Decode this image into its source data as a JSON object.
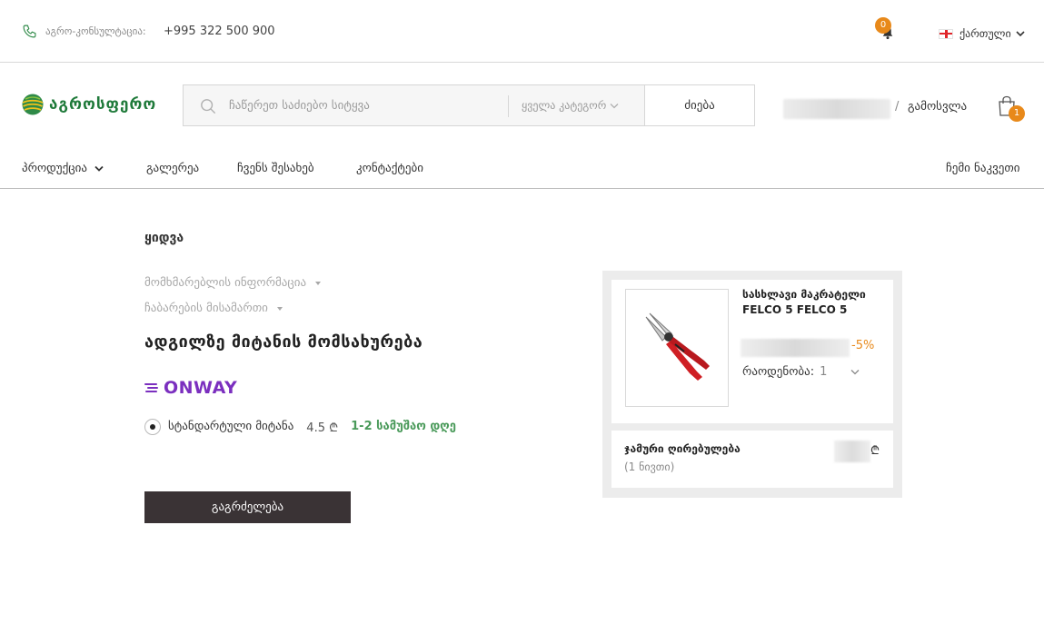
{
  "topbar": {
    "consult_label": "აგრო-კონსულტაცია:",
    "phone": "+995 322 500 900",
    "notifications_count": "0",
    "language": "ქართული"
  },
  "header": {
    "logo_text": "აგროსფერო",
    "search_placeholder": "ჩაწერეთ საძიებო სიტყვა",
    "category_select": "ყველა კატეგორ",
    "search_button": "ძიება",
    "slash": "/",
    "logout": "გამოსვლა",
    "cart_count": "1"
  },
  "nav": {
    "products": "პროდუქცია",
    "gallery": "გალერეა",
    "about": "ჩვენს შესახებ",
    "contacts": "კონტაქტები",
    "my_cart": "ჩემი ნაკვეთი"
  },
  "checkout": {
    "title": "ყიდვა",
    "step_user": "მომხმარებლის ინფორმაცია",
    "step_address": "ჩაბარების მისამართი",
    "section_title": "ადგილზე მიტანის მომსახურება",
    "courier_brand": "ONWAY",
    "shipping": {
      "label": "სტანდარტული მიტანა",
      "price": "4.5 ₾",
      "time": "1-2 სამუშაო დღე"
    },
    "continue_button": "გაგრძელება"
  },
  "summary": {
    "product_name": "სასხლავი მაკრატელი FELCO 5 FELCO 5",
    "discount": "-5%",
    "quantity_label": "რაოდენობა:",
    "quantity_value": "1",
    "total_label": "ჯამური ღირებულება",
    "total_count": "(1 ნივთი)",
    "currency": "₾"
  },
  "colors": {
    "brand_green": "#1f7a3a",
    "accent_orange": "#e8891a",
    "button_dark": "#3a3335",
    "onway_purple": "#7b2fbf",
    "delivery_green": "#4a9a5a"
  },
  "icons": {
    "phone": "phone-icon",
    "bell": "bell-icon",
    "flag": "georgia-flag-icon",
    "search": "search-icon",
    "cart": "shopping-bag-icon",
    "chevron": "chevron-down-icon"
  }
}
